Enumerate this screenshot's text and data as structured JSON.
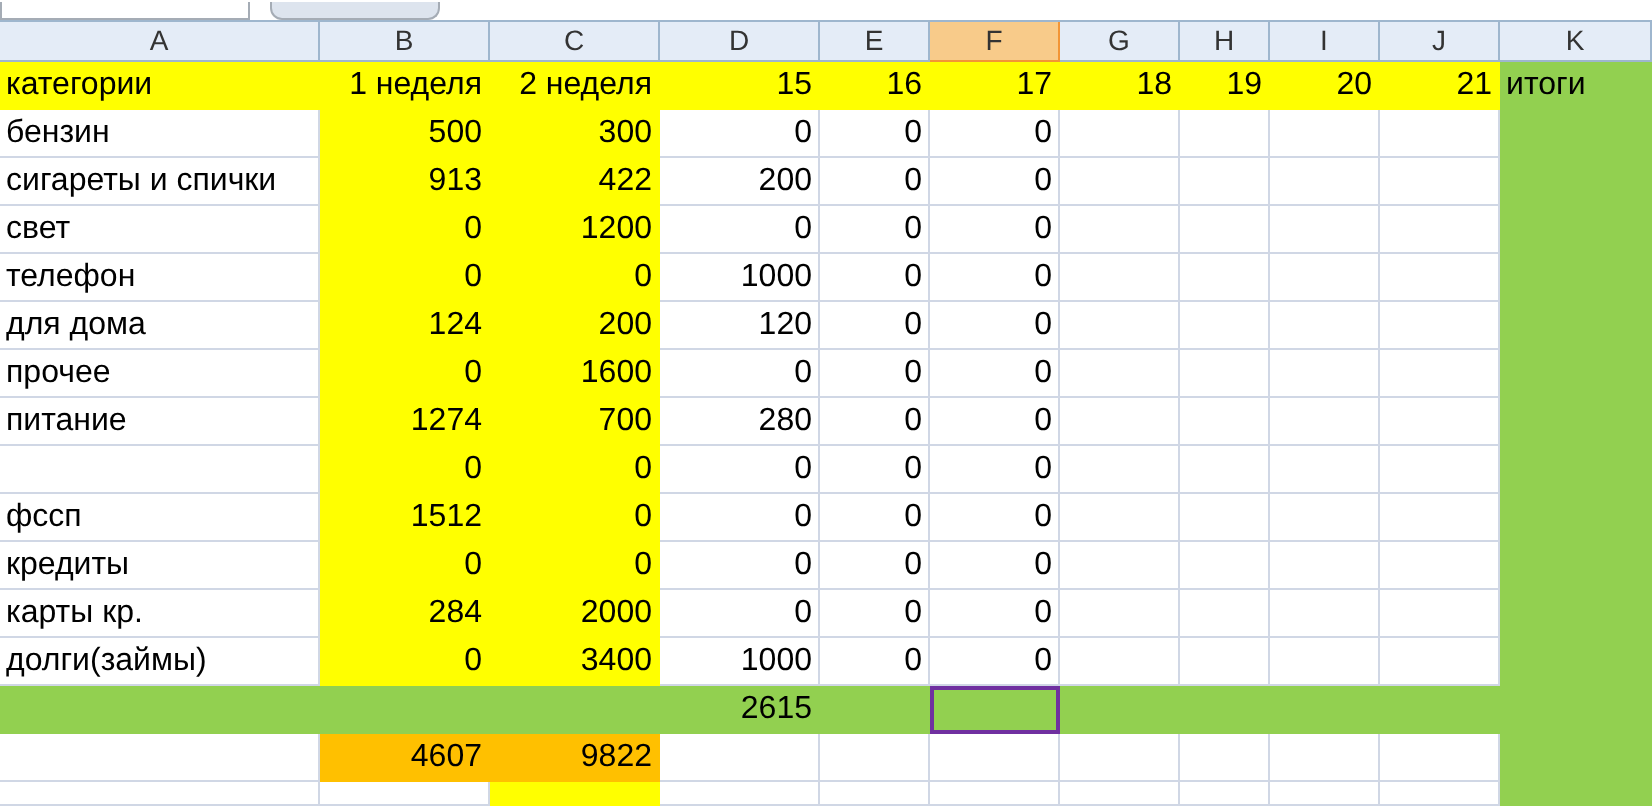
{
  "columns": [
    {
      "label": "A",
      "selected": false
    },
    {
      "label": "B",
      "selected": false
    },
    {
      "label": "C",
      "selected": false
    },
    {
      "label": "D",
      "selected": false
    },
    {
      "label": "E",
      "selected": false
    },
    {
      "label": "F",
      "selected": true
    },
    {
      "label": "G",
      "selected": false
    },
    {
      "label": "H",
      "selected": false
    },
    {
      "label": "I",
      "selected": false
    },
    {
      "label": "J",
      "selected": false
    },
    {
      "label": "K",
      "selected": false
    }
  ],
  "rows": [
    {
      "selected": false,
      "cells": [
        {
          "v": "категории",
          "color": "#ffff00"
        },
        {
          "v": "1 неделя",
          "color": "#ffff00"
        },
        {
          "v": "2 неделя",
          "color": "#ffff00"
        },
        {
          "v": "15",
          "color": "#ffff00"
        },
        {
          "v": "16",
          "color": "#ffff00"
        },
        {
          "v": "17",
          "color": "#ffff00"
        },
        {
          "v": "18",
          "color": "#ffff00"
        },
        {
          "v": "19",
          "color": "#ffff00"
        },
        {
          "v": "20",
          "color": "#ffff00"
        },
        {
          "v": "21",
          "color": "#ffff00"
        },
        {
          "v": "итоги",
          "color": "#92d050"
        }
      ]
    },
    {
      "selected": false,
      "cells": [
        {
          "v": "бензин"
        },
        {
          "v": "500",
          "color": "#ffff00"
        },
        {
          "v": "300",
          "color": "#ffff00"
        },
        {
          "v": "0"
        },
        {
          "v": "0"
        },
        {
          "v": "0"
        },
        {},
        {},
        {},
        {},
        {
          "color": "#92d050"
        }
      ]
    },
    {
      "selected": false,
      "cells": [
        {
          "v": "сигареты и спички"
        },
        {
          "v": "913",
          "color": "#ffff00"
        },
        {
          "v": "422",
          "color": "#ffff00"
        },
        {
          "v": "200"
        },
        {
          "v": "0"
        },
        {
          "v": "0"
        },
        {},
        {},
        {},
        {},
        {
          "color": "#92d050"
        }
      ]
    },
    {
      "selected": false,
      "cells": [
        {
          "v": "свет"
        },
        {
          "v": "0",
          "color": "#ffff00"
        },
        {
          "v": "1200",
          "color": "#ffff00"
        },
        {
          "v": "0"
        },
        {
          "v": "0"
        },
        {
          "v": "0"
        },
        {},
        {},
        {},
        {},
        {
          "color": "#92d050"
        }
      ]
    },
    {
      "selected": false,
      "cells": [
        {
          "v": "телефон"
        },
        {
          "v": "0",
          "color": "#ffff00"
        },
        {
          "v": "0",
          "color": "#ffff00"
        },
        {
          "v": "1000"
        },
        {
          "v": "0"
        },
        {
          "v": "0"
        },
        {},
        {},
        {},
        {},
        {
          "color": "#92d050"
        }
      ]
    },
    {
      "selected": false,
      "cells": [
        {
          "v": "для дома"
        },
        {
          "v": "124",
          "color": "#ffff00"
        },
        {
          "v": "200",
          "color": "#ffff00"
        },
        {
          "v": "120"
        },
        {
          "v": "0"
        },
        {
          "v": "0"
        },
        {},
        {},
        {},
        {},
        {
          "color": "#92d050"
        }
      ]
    },
    {
      "selected": false,
      "cells": [
        {
          "v": "прочее"
        },
        {
          "v": "0",
          "color": "#ffff00"
        },
        {
          "v": "1600",
          "color": "#ffff00"
        },
        {
          "v": "0"
        },
        {
          "v": "0"
        },
        {
          "v": "0"
        },
        {},
        {},
        {},
        {},
        {
          "color": "#92d050"
        }
      ]
    },
    {
      "selected": false,
      "cells": [
        {
          "v": "питание"
        },
        {
          "v": "1274",
          "color": "#ffff00"
        },
        {
          "v": "700",
          "color": "#ffff00"
        },
        {
          "v": "280"
        },
        {
          "v": "0"
        },
        {
          "v": "0"
        },
        {},
        {},
        {},
        {},
        {
          "color": "#92d050"
        }
      ]
    },
    {
      "selected": false,
      "cells": [
        {},
        {
          "v": "0",
          "color": "#ffff00"
        },
        {
          "v": "0",
          "color": "#ffff00"
        },
        {
          "v": "0"
        },
        {
          "v": "0"
        },
        {
          "v": "0"
        },
        {},
        {},
        {},
        {},
        {
          "color": "#92d050"
        }
      ]
    },
    {
      "selected": false,
      "cells": [
        {
          "v": "фссп"
        },
        {
          "v": "1512",
          "color": "#ffff00"
        },
        {
          "v": "0",
          "color": "#ffff00"
        },
        {
          "v": "0"
        },
        {
          "v": "0"
        },
        {
          "v": "0"
        },
        {},
        {},
        {},
        {},
        {
          "color": "#92d050"
        }
      ]
    },
    {
      "selected": false,
      "cells": [
        {
          "v": "кредиты"
        },
        {
          "v": "0",
          "color": "#ffff00"
        },
        {
          "v": "0",
          "color": "#ffff00"
        },
        {
          "v": "0"
        },
        {
          "v": "0"
        },
        {
          "v": "0"
        },
        {},
        {},
        {},
        {},
        {
          "color": "#92d050"
        }
      ]
    },
    {
      "selected": false,
      "cells": [
        {
          "v": "карты кр."
        },
        {
          "v": "284",
          "color": "#ffff00"
        },
        {
          "v": "2000",
          "color": "#ffff00"
        },
        {
          "v": "0"
        },
        {
          "v": "0"
        },
        {
          "v": "0"
        },
        {},
        {},
        {},
        {},
        {
          "color": "#92d050"
        }
      ]
    },
    {
      "selected": false,
      "cells": [
        {
          "v": "долги(займы)"
        },
        {
          "v": "0",
          "color": "#ffff00"
        },
        {
          "v": "3400",
          "color": "#ffff00"
        },
        {
          "v": "1000"
        },
        {
          "v": "0"
        },
        {
          "v": "0"
        },
        {},
        {},
        {},
        {},
        {
          "color": "#92d050"
        }
      ]
    },
    {
      "selected": true,
      "cells": [
        {
          "color": "#92d050"
        },
        {
          "color": "#92d050"
        },
        {
          "color": "#92d050"
        },
        {
          "v": "2615",
          "color": "#92d050"
        },
        {
          "color": "#92d050"
        },
        {
          "color": "#92d050"
        },
        {
          "color": "#92d050"
        },
        {
          "color": "#92d050"
        },
        {
          "color": "#92d050"
        },
        {
          "color": "#92d050"
        },
        {
          "color": "#92d050"
        }
      ]
    },
    {
      "selected": false,
      "cells": [
        {},
        {
          "v": "4607",
          "color": "#ffc000"
        },
        {
          "v": "9822",
          "color": "#ffc000"
        },
        {},
        {},
        {},
        {},
        {},
        {},
        {},
        {
          "color": "#92d050"
        }
      ]
    },
    {
      "selected": false,
      "cells": [
        {},
        {},
        {
          "color": "#ffff00"
        },
        {},
        {},
        {},
        {},
        {},
        {},
        {},
        {
          "color": "#92d050"
        }
      ]
    }
  ]
}
